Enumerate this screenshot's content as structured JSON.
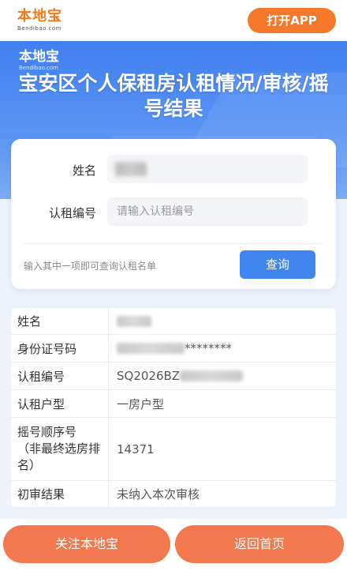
{
  "header": {
    "logo_cn": "本地宝",
    "logo_en": "Bendibao.com",
    "open_app_label": "打开APP"
  },
  "hero": {
    "logo_cn": "本地宝",
    "logo_en": "Bendibao.com",
    "title": "宝安区个人保租房认租情况/审核/摇号结果"
  },
  "query": {
    "name_label": "姓名",
    "id_label": "认租编号",
    "id_placeholder": "请输入认租编号",
    "hint": "输入其中一项即可查询认租名单",
    "submit_label": "查询"
  },
  "result": {
    "rows": [
      {
        "key": "姓名",
        "value": ""
      },
      {
        "key": "身份证号码",
        "value_prefix": "",
        "value_suffix": "********"
      },
      {
        "key": "认租编号",
        "value_prefix": "SQ2026BZ"
      },
      {
        "key": "认租户型",
        "value": "一房户型"
      },
      {
        "key": "摇号顺序号\n（非最终选房排名）",
        "value": "14371"
      },
      {
        "key": "初审结果",
        "value": "未纳入本次审核"
      }
    ]
  },
  "footer": {
    "follow_label": "关注本地宝",
    "home_label": "返回首页"
  },
  "colors": {
    "accent_orange": "#f7782a",
    "accent_blue": "#3f86ee"
  }
}
